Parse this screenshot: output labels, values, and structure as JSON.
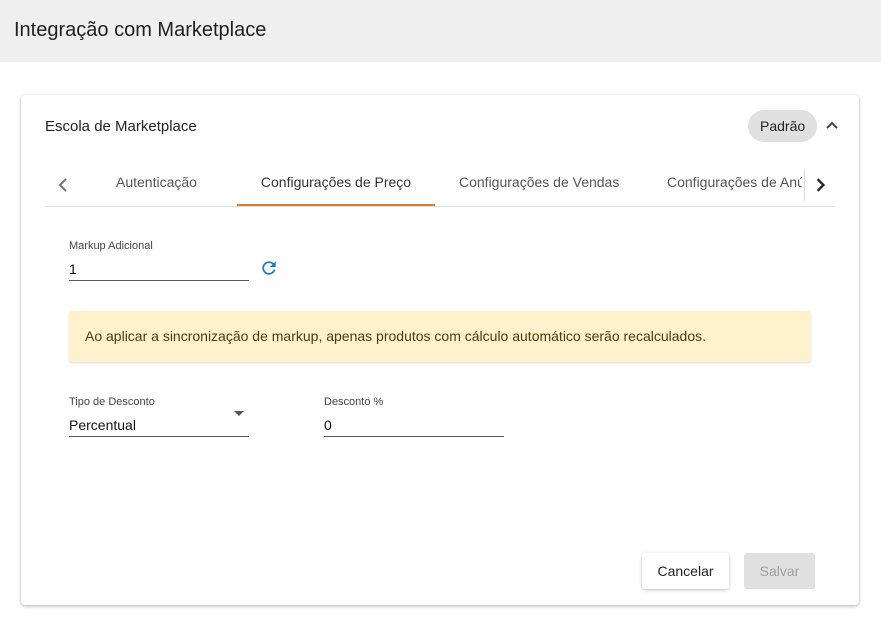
{
  "header": {
    "title": "Integração com Marketplace"
  },
  "card": {
    "title": "Escola de Marketplace",
    "chip": "Padrão"
  },
  "tabs": [
    {
      "label": "Autenticação",
      "active": false
    },
    {
      "label": "Configurações de Preço",
      "active": true
    },
    {
      "label": "Configurações de Vendas",
      "active": false
    },
    {
      "label": "Configurações de Anúncios",
      "active": false
    }
  ],
  "form": {
    "markup": {
      "label": "Markup Adicional",
      "value": "1"
    },
    "alert": "Ao aplicar a sincronização de markup, apenas produtos com cálculo automático serão recalculados.",
    "discount_type": {
      "label": "Tipo de Desconto",
      "value": "Percentual"
    },
    "discount": {
      "label": "Desconto %",
      "value": "0"
    }
  },
  "actions": {
    "cancel": "Cancelar",
    "save": "Salvar"
  },
  "colors": {
    "tab_indicator": "#e07b2a",
    "refresh_icon": "#1976d2",
    "alert_bg": "#fdf2cb"
  },
  "icons": [
    "chevron-up-icon",
    "chevron-left-icon",
    "chevron-right-icon",
    "refresh-icon",
    "dropdown-arrow-icon"
  ]
}
